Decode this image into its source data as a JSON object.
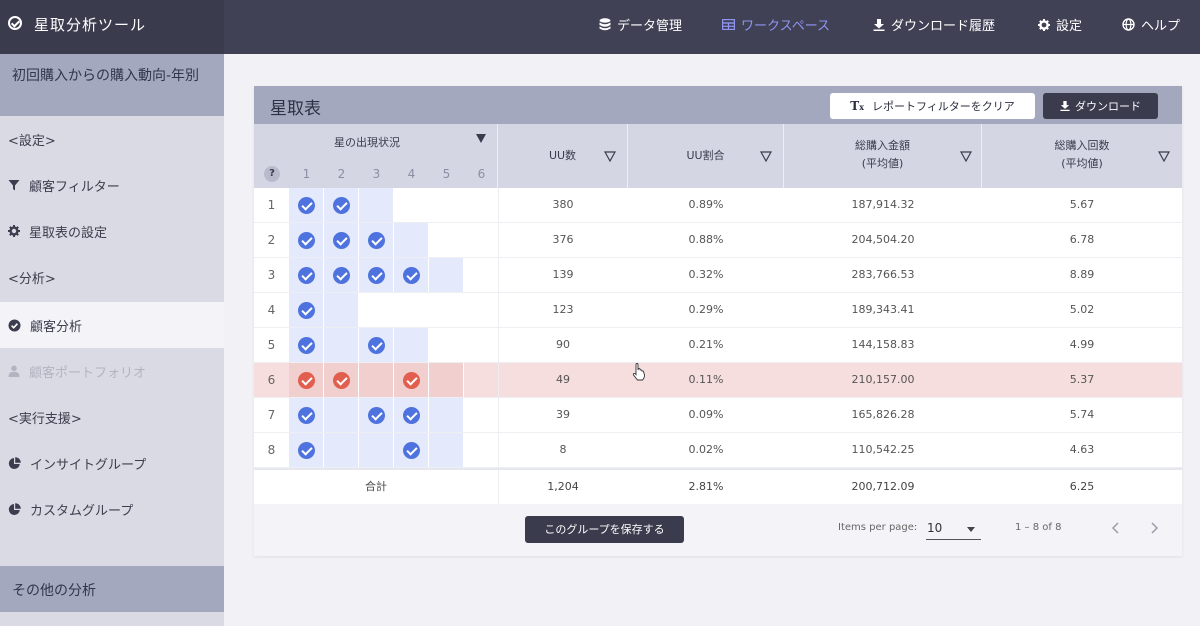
{
  "app": {
    "title": "星取分析ツール"
  },
  "nav": {
    "data_mgmt": "データ管理",
    "workspace": "ワークスペース",
    "dl_history": "ダウンロード履歴",
    "settings": "設定",
    "help": "ヘルプ"
  },
  "colors": {
    "accent": "#8f94f0",
    "check_blue": "#4f73de",
    "check_red": "#e25f4f",
    "header_dark": "#3a3b4d",
    "header_light": "#a3a8bf"
  },
  "sidebar": {
    "section_title": "初回購入からの購入動向-年別",
    "settings_group": "<設定>",
    "customer_filter": "顧客フィルター",
    "star_settings": "星取表の設定",
    "analysis_group": "<分析>",
    "customer_analysis": "顧客分析",
    "customer_portfolio": "顧客ポートフォリオ",
    "execution_group": "<実行支援>",
    "insight_group": "インサイトグループ",
    "custom_group": "カスタムグループ",
    "other_analysis": "その他の分析"
  },
  "card": {
    "title": "星取表",
    "clear_filter": "レポートフィルターをクリア",
    "download": "ダウンロード"
  },
  "table": {
    "star_header": "星の出現状況",
    "help_mark": "?",
    "star_cols": [
      "1",
      "2",
      "3",
      "4",
      "5",
      "6"
    ],
    "uu_count": "UU数",
    "uu_ratio": "UU割合",
    "total_amount_line1": "総購入金額",
    "total_amount_line2": "(平均値)",
    "total_count_line1": "総購入回数",
    "total_count_line2": "(平均値)",
    "rows": [
      {
        "idx": "1",
        "stars": [
          1,
          1,
          0,
          0,
          0,
          0
        ],
        "span": 4,
        "uu": "380",
        "ratio": "0.89%",
        "amount": "187,914.32",
        "count": "5.67"
      },
      {
        "idx": "2",
        "stars": [
          1,
          1,
          1,
          0,
          0,
          0
        ],
        "span": 5,
        "uu": "376",
        "ratio": "0.88%",
        "amount": "204,504.20",
        "count": "6.78"
      },
      {
        "idx": "3",
        "stars": [
          1,
          1,
          1,
          1,
          0,
          0
        ],
        "span": 6,
        "uu": "139",
        "ratio": "0.32%",
        "amount": "283,766.53",
        "count": "8.89"
      },
      {
        "idx": "4",
        "stars": [
          1,
          0,
          0,
          0,
          0,
          0
        ],
        "span": 3,
        "uu": "123",
        "ratio": "0.29%",
        "amount": "189,343.41",
        "count": "5.02"
      },
      {
        "idx": "5",
        "stars": [
          1,
          0,
          1,
          0,
          0,
          0
        ],
        "span": 5,
        "uu": "90",
        "ratio": "0.21%",
        "amount": "144,158.83",
        "count": "4.99"
      },
      {
        "idx": "6",
        "stars": [
          1,
          1,
          0,
          1,
          0,
          0
        ],
        "span": 6,
        "uu": "49",
        "ratio": "0.11%",
        "amount": "210,157.00",
        "count": "5.37",
        "highlight": true
      },
      {
        "idx": "7",
        "stars": [
          1,
          0,
          1,
          1,
          0,
          0
        ],
        "span": 6,
        "uu": "39",
        "ratio": "0.09%",
        "amount": "165,826.28",
        "count": "5.74"
      },
      {
        "idx": "8",
        "stars": [
          1,
          0,
          0,
          1,
          0,
          0
        ],
        "span": 6,
        "uu": "8",
        "ratio": "0.02%",
        "amount": "110,542.25",
        "count": "4.63"
      }
    ],
    "total": {
      "label": "合計",
      "uu": "1,204",
      "ratio": "2.81%",
      "amount": "200,712.09",
      "count": "6.25"
    }
  },
  "footer": {
    "save_group": "このグループを保存する",
    "items_per_page_label": "Items per page:",
    "items_per_page": "10",
    "range": "1 – 8 of 8"
  }
}
